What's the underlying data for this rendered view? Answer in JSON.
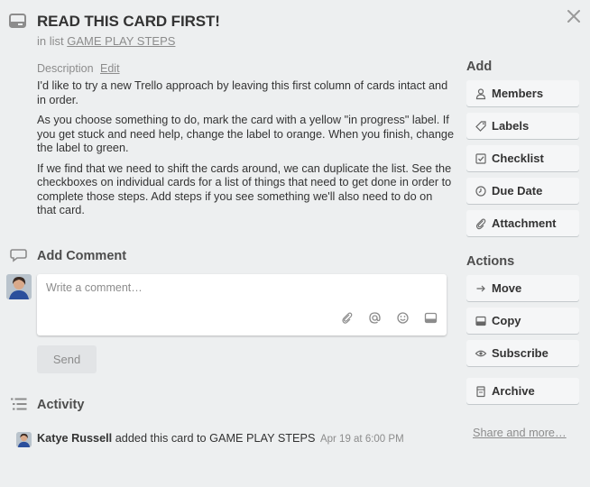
{
  "card": {
    "title": "READ THIS CARD FIRST!",
    "in_list_prefix": "in list",
    "list_name": "GAME PLAY STEPS"
  },
  "description": {
    "label": "Description",
    "edit_label": "Edit",
    "paragraphs": [
      "I'd like to try a new Trello approach by leaving this first column of cards intact and in order.",
      "As you choose something to do, mark the card with a yellow \"in progress\" label. If you get stuck and need help, change the label to orange. When you finish, change the label to green.",
      "If we find that we need to shift the cards around, we can duplicate the list. See the checkboxes on individual cards for a list of things that need to get done in order to complete those steps. Add steps if you see something we'll also need to do on that card."
    ]
  },
  "comment": {
    "heading": "Add Comment",
    "placeholder": "Write a comment…",
    "send_label": "Send",
    "tool_icons": [
      "paperclip-icon",
      "at-icon",
      "emoji-icon",
      "card-icon"
    ]
  },
  "activity": {
    "heading": "Activity",
    "entries": [
      {
        "user": "Katye Russell",
        "action": "added this card to GAME PLAY STEPS",
        "time": "Apr 19 at 6:00 PM"
      }
    ]
  },
  "sidebar": {
    "add_heading": "Add",
    "add_buttons": [
      {
        "label": "Members",
        "icon": "person-icon"
      },
      {
        "label": "Labels",
        "icon": "tag-icon"
      },
      {
        "label": "Checklist",
        "icon": "checkbox-icon"
      },
      {
        "label": "Due Date",
        "icon": "clock-icon"
      },
      {
        "label": "Attachment",
        "icon": "paperclip-icon"
      }
    ],
    "actions_heading": "Actions",
    "action_buttons": [
      {
        "label": "Move",
        "icon": "arrow-right-icon"
      },
      {
        "label": "Copy",
        "icon": "card-icon"
      },
      {
        "label": "Subscribe",
        "icon": "eye-icon"
      },
      {
        "label": "Archive",
        "icon": "archive-icon"
      }
    ],
    "share_label": "Share and more…"
  },
  "colors": {
    "background": "#edeff0",
    "button": "#f5f6f7",
    "muted_text": "#8c8c8c",
    "text": "#333333"
  }
}
